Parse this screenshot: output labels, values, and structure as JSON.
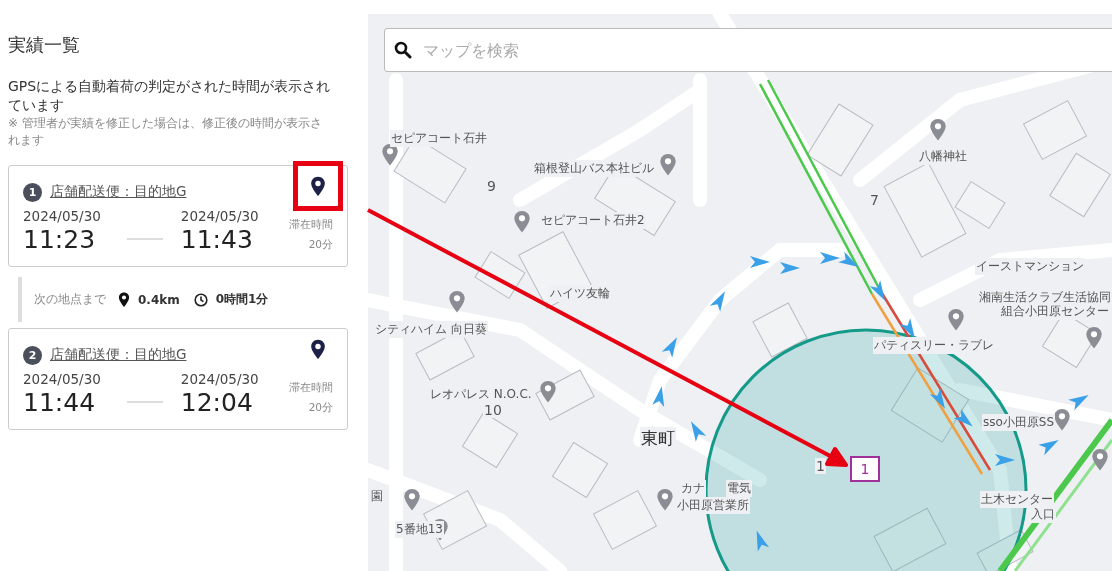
{
  "panel": {
    "title": "実績一覧",
    "description": "GPSによる自動着荷の判定がされた時間が表示されています",
    "note": "※ 管理者が実績を修正した場合は、修正後の時間が表示されます"
  },
  "records": [
    {
      "number": "1",
      "name": "店舗配送便：目的地G",
      "start_date": "2024/05/30",
      "start_time": "11:23",
      "end_date": "2024/05/30",
      "end_time": "11:43",
      "stay_label": "滞在時間",
      "stay": "20分",
      "highlighted": true
    },
    {
      "number": "2",
      "name": "店舗配送便：目的地G",
      "start_date": "2024/05/30",
      "start_time": "11:44",
      "end_date": "2024/05/30",
      "end_time": "12:04",
      "stay_label": "滞在時間",
      "stay": "20分",
      "highlighted": false
    }
  ],
  "legs": [
    {
      "label": "次の地点まで",
      "distance": "0.4km",
      "duration": "0時間1分"
    }
  ],
  "map": {
    "search": {
      "placeholder": "マップを検索"
    },
    "labels": [
      {
        "text": "セピアコート石井",
        "kind": "place"
      },
      {
        "text": "9",
        "kind": "block"
      },
      {
        "text": "箱根登山バス本社ビル",
        "kind": "place"
      },
      {
        "text": "セピアコート石井2",
        "kind": "place"
      },
      {
        "text": "八幡神社",
        "kind": "place"
      },
      {
        "text": "7",
        "kind": "block"
      },
      {
        "text": "イーストマンション",
        "kind": "place"
      },
      {
        "text": "湘南生活クラブ生活協同",
        "kind": "place"
      },
      {
        "text": "組合小田原センター",
        "kind": "place"
      },
      {
        "text": "ハイツ友輪",
        "kind": "place"
      },
      {
        "text": "シティハイム 向日葵",
        "kind": "place"
      },
      {
        "text": "パティスリー・ラブレ",
        "kind": "place"
      },
      {
        "text": "レオパレス N.O.C.",
        "kind": "place"
      },
      {
        "text": "10",
        "kind": "block"
      },
      {
        "text": "東町",
        "kind": "area"
      },
      {
        "text": "1",
        "kind": "block"
      },
      {
        "text": "カナ",
        "kind": "place"
      },
      {
        "text": "電気",
        "kind": "place"
      },
      {
        "text": "小田原営業所",
        "kind": "place"
      },
      {
        "text": "sso小田原SS",
        "kind": "place"
      },
      {
        "text": "園",
        "kind": "place"
      },
      {
        "text": "5番地13",
        "kind": "place"
      },
      {
        "text": "土木センター",
        "kind": "place"
      },
      {
        "text": "入口",
        "kind": "place"
      }
    ],
    "marker": {
      "label": "1"
    }
  }
}
